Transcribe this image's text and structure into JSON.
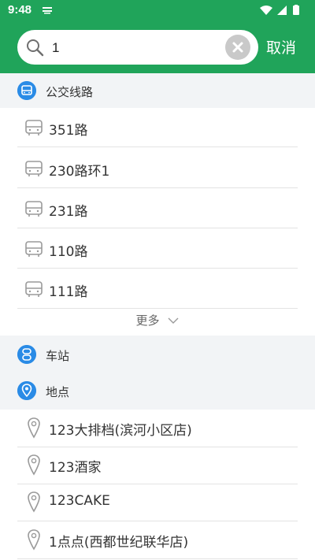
{
  "status_bar": {
    "time": "9:48"
  },
  "search": {
    "query": "1",
    "cancel_label": "取消"
  },
  "sections": {
    "bus_lines": {
      "title": "公交线路",
      "items": [
        "351路",
        "230路环1",
        "231路",
        "110路",
        "111路"
      ],
      "more_label": "更多"
    },
    "stations": {
      "title": "车站"
    },
    "places": {
      "title": "地点",
      "items": [
        "123大排档(滨河小区店)",
        "123酒家",
        "123CAKE",
        "1点点(西都世纪联华店)"
      ]
    }
  },
  "colors": {
    "header_green": "#20a45a",
    "section_icon_blue": "#2a8be6",
    "section_bg": "#f2f4f6"
  },
  "icons": {
    "bus_line_item": "bus-icon",
    "place_item": "location-pin-icon",
    "section_bus": "bus-icon",
    "section_station": "station-icon",
    "section_place": "location-icon"
  }
}
